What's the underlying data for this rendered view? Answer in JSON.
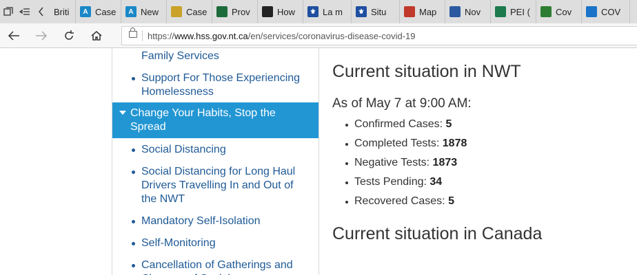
{
  "browser": {
    "tabs": [
      {
        "label": "Briti",
        "fav": "",
        "fav_color": ""
      },
      {
        "label": "Case",
        "fav": "A",
        "fav_color": "#1b88c8"
      },
      {
        "label": "New",
        "fav": "A",
        "fav_color": "#1b88c8"
      },
      {
        "label": "Case",
        "fav": "",
        "fav_color": "#c9a227"
      },
      {
        "label": "Prov",
        "fav": "",
        "fav_color": "#1d6b3a"
      },
      {
        "label": "How",
        "fav": "",
        "fav_color": "#222222"
      },
      {
        "label": "La m",
        "fav": "⚜",
        "fav_color": "#1e4fa0"
      },
      {
        "label": "Situ",
        "fav": "⚜",
        "fav_color": "#1e4fa0"
      },
      {
        "label": "Map",
        "fav": "",
        "fav_color": "#c0392b"
      },
      {
        "label": "Nov",
        "fav": "",
        "fav_color": "#2c5aa0"
      },
      {
        "label": "PEI (",
        "fav": "",
        "fav_color": "#1d7a4d"
      },
      {
        "label": "Cov",
        "fav": "",
        "fav_color": "#2e7d32"
      },
      {
        "label": "COV",
        "fav": "",
        "fav_color": "#1a73c8"
      }
    ],
    "url_prefix": "https://",
    "url_host": "www.hss.gov.nt.ca",
    "url_path": "/en/services/coronavirus-disease-covid-19"
  },
  "sidebar": {
    "item0": "Family Services",
    "item1": "Support For Those Experiencing Homelessness",
    "active": "Change Your Habits, Stop the Spread",
    "item2": "Social Distancing",
    "item3": "Social Distancing for Long Haul Drivers Travelling In and Out of the NWT",
    "item4": "Mandatory Self-Isolation",
    "item5": "Self-Monitoring",
    "item6": "Cancellation of Gatherings and Closures of Social..."
  },
  "main": {
    "title": "Current situation in NWT",
    "as_of": "As of May 7 at 9:00 AM:",
    "stats": [
      {
        "label": "Confirmed Cases:",
        "value": "5"
      },
      {
        "label": "Completed Tests:",
        "value": "1878"
      },
      {
        "label": "Negative Tests:",
        "value": "1873"
      },
      {
        "label": "Tests Pending:",
        "value": "34"
      },
      {
        "label": "Recovered Cases:",
        "value": "5"
      }
    ],
    "title2": "Current situation in Canada"
  }
}
